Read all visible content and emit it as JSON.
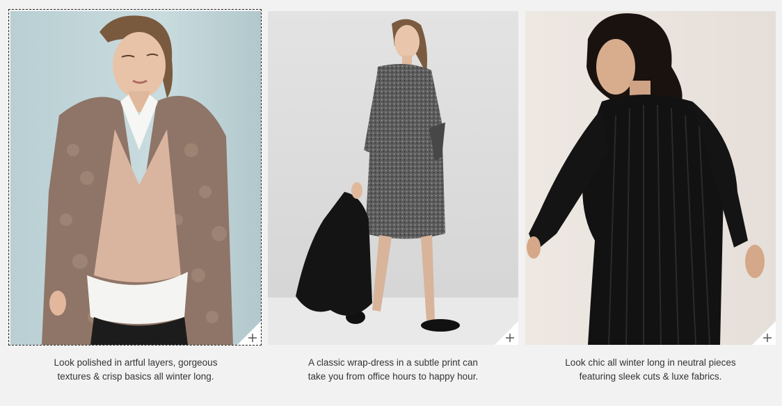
{
  "cards": [
    {
      "caption_line1": "Look polished in artful layers, gorgeous",
      "caption_line2": "textures & crisp basics all winter long.",
      "expand_icon": "plus-icon"
    },
    {
      "caption_line1": "A classic wrap-dress in a subtle print can",
      "caption_line2": "take you from office hours to happy hour.",
      "expand_icon": "plus-icon"
    },
    {
      "caption_line1": "Look chic all winter long in neutral pieces",
      "caption_line2": "featuring sleek cuts & luxe fabrics.",
      "expand_icon": "plus-icon"
    }
  ],
  "colors": {
    "page_background": "#f2f2f2",
    "caption_text": "#333333",
    "photo1_backdrop": "#c6d8db",
    "photo2_backdrop": "#dcdcdc",
    "photo3_backdrop": "#ece6e1"
  }
}
